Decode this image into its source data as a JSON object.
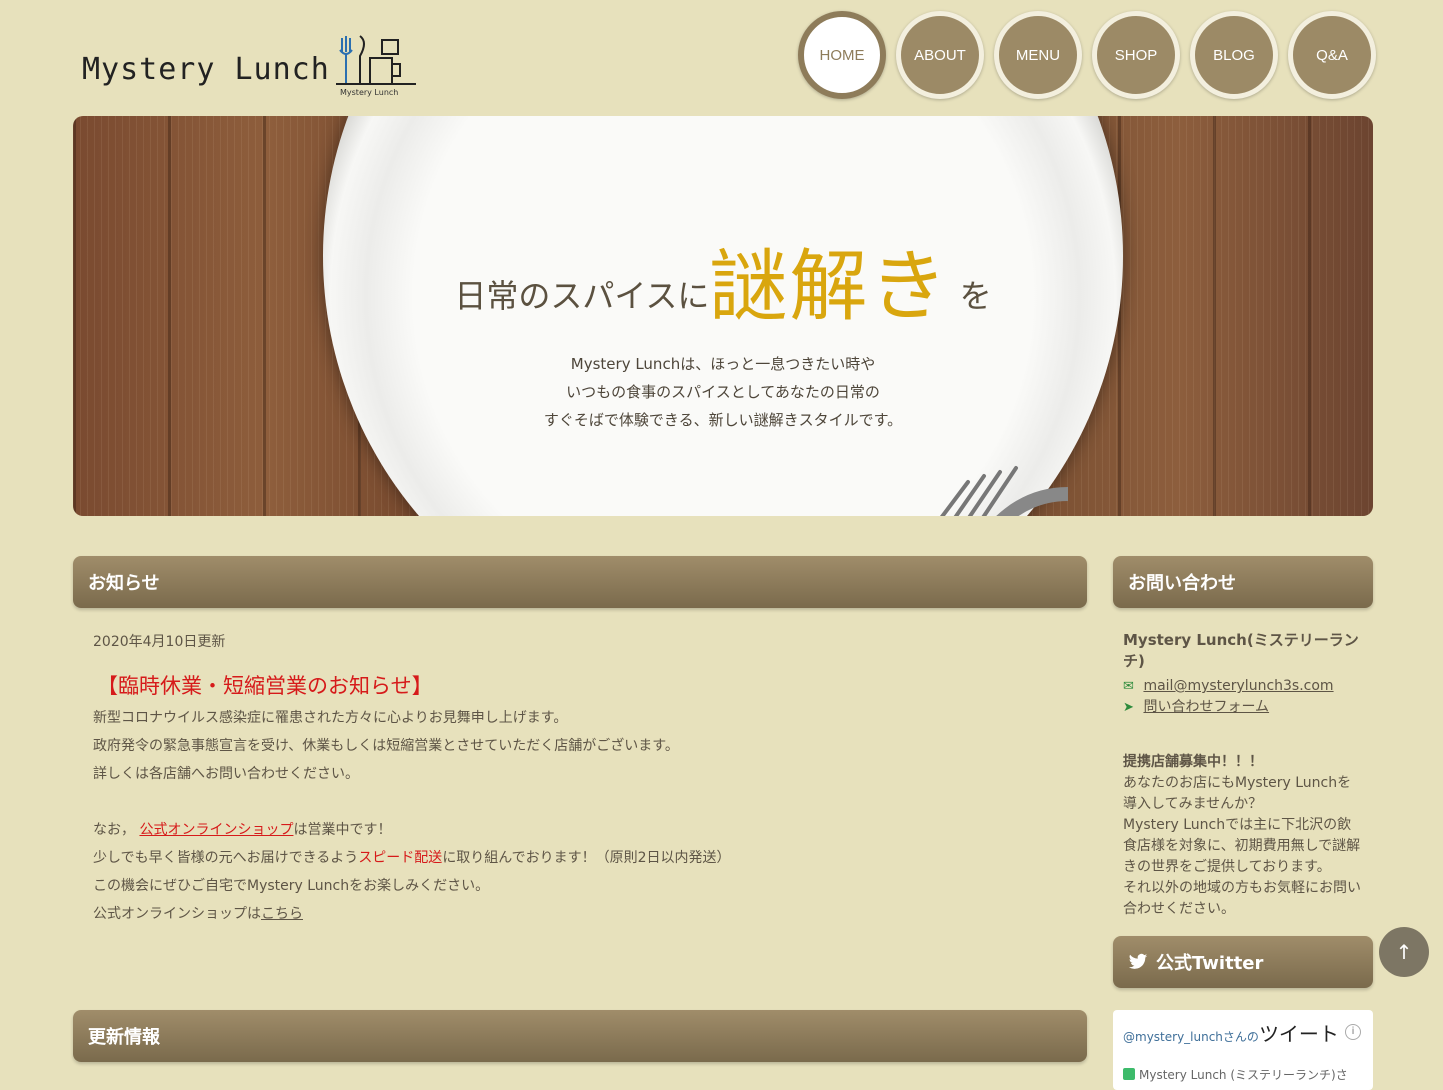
{
  "logo": {
    "name": "Mystery Lunch",
    "sub": "Mystery Lunch"
  },
  "nav": [
    "HOME",
    "ABOUT",
    "MENU",
    "SHOP",
    "BLOG",
    "Q&A"
  ],
  "hero": {
    "title_before": "日常のスパイスに",
    "title_big": "謎解き",
    "title_after": "を",
    "lead": [
      "Mystery Lunchは、ほっと一息つきたい時や",
      "いつもの食事のスパイスとしてあなたの日常の",
      "すぐそばで体験できる、新しい謎解きスタイルです。"
    ]
  },
  "news": {
    "heading": "お知らせ",
    "date": "2020年4月10日更新",
    "headline": "【臨時休業・短縮営業のお知らせ】",
    "lines": [
      "新型コロナウイルス感染症に罹患された方々に心よりお見舞申し上げます。",
      "政府発令の緊急事態宣言を受け、休業もしくは短縮営業とさせていただく店舗がございます。",
      "詳しくは各店舗へお問い合わせください。"
    ],
    "p2_prefix": "なお，",
    "p2_link": "公式オンラインショップ",
    "p2_suffix": "は営業中です！",
    "p3_prefix": "少しでも早く皆様の元へお届けできるよう",
    "p3_red": "スピード配送",
    "p3_suffix": "に取り組んでおります！（原則2日以内発送）",
    "p4": "この機会にぜひご自宅でMystery Lunchをお楽しみください。",
    "p5_prefix": "公式オンラインショップは",
    "p5_link": "こちら"
  },
  "updates": {
    "heading": "更新情報"
  },
  "contact": {
    "heading": "お問い合わせ",
    "org": "Mystery Lunch(ミステリーランチ)",
    "email": "mail@mysterylunch3s.com",
    "form": "問い合わせフォーム",
    "recruit_title": "提携店舗募集中！！！",
    "recruit_lines": [
      "あなたのお店にもMystery Lunchを",
      "導入してみませんか？",
      "Mystery Lunchでは主に下北沢の飲",
      "食店様を対象に、初期費用無しで謎解",
      "きの世界をご提供しております。",
      "それ以外の地域の方もお気軽にお問い",
      "合わせください。"
    ]
  },
  "twitter": {
    "heading": "公式Twitter",
    "handle": "@mystery_lunch",
    "san_no": "さんの",
    "tweets": "ツイート",
    "account": "Mystery Lunch (ミステリーランチ)さ"
  },
  "to_top": "↑",
  "colors": {
    "background": "#e7e1bc",
    "nav": "#9c8a66",
    "accent": "#d9a60e",
    "alert": "#d61a1a",
    "header_bar": "#8e7c5a"
  }
}
